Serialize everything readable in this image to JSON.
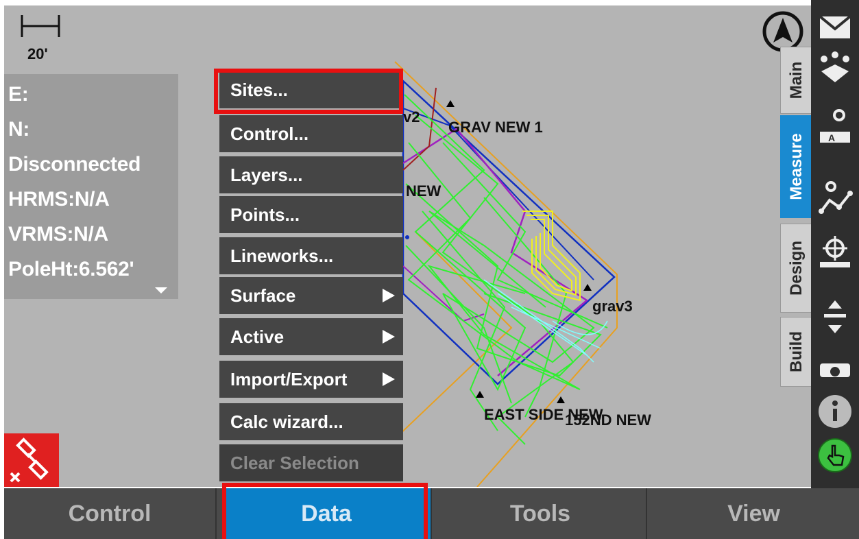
{
  "scale": {
    "label": "20'"
  },
  "info_panel": {
    "lines": [
      "E:",
      "N:",
      "Disconnected",
      "HRMS:N/A",
      "VRMS:N/A",
      "PoleHt:6.562'"
    ]
  },
  "data_menu": {
    "items": [
      {
        "label": "Sites..."
      },
      {
        "label": "Control..."
      },
      {
        "label": "Layers..."
      },
      {
        "label": "Points..."
      },
      {
        "label": "Lineworks..."
      },
      {
        "label": "Surface"
      },
      {
        "label": "Active"
      },
      {
        "label": "Import/Export"
      },
      {
        "label": "Calc wizard..."
      },
      {
        "label": "Clear Selection"
      }
    ]
  },
  "map_labels": {
    "grav2_partial": "v2",
    "grav_new_1": "GRAV NEW 1",
    "new_partial": "NEW",
    "grav3": "grav3",
    "east_side_new": "EAST SIDE NEW",
    "n152nd_new": "152ND NEW"
  },
  "vertical_tabs": [
    "Main",
    "Measure",
    "Design",
    "Build"
  ],
  "bottom_tabs": [
    "Control",
    "Data",
    "Tools",
    "View"
  ],
  "icons": {
    "compass": "north-arrow-icon",
    "gps_status": "satellite-disconnected-icon",
    "right_bar": [
      "map-envelope-icon",
      "points-map-icon",
      "map-text-icon",
      "polyline-icon",
      "crosshair-map-icon",
      "elevation-arrows-icon",
      "camera-icon",
      "info-icon",
      "hand-pointer-icon"
    ]
  },
  "colors": {
    "active_tab": "#0a80c8",
    "highlight": "#e81010",
    "gps_status_bg": "#e02020",
    "menu_bg": "#454545"
  }
}
